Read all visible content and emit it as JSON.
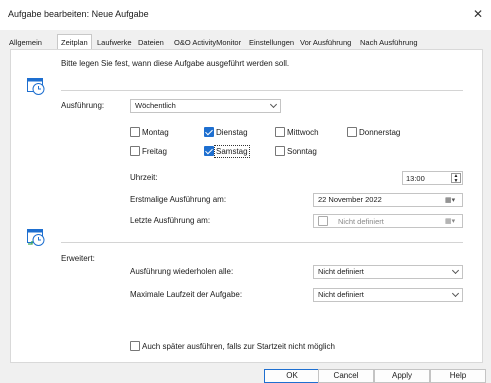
{
  "window": {
    "title": "Aufgabe bearbeiten: Neue Aufgabe"
  },
  "tabs": [
    {
      "label": "Allgemein"
    },
    {
      "label": "Zeitplan"
    },
    {
      "label": "Laufwerke"
    },
    {
      "label": "Dateien"
    },
    {
      "label": "O&O ActivityMonitor"
    },
    {
      "label": "Einstellungen"
    },
    {
      "label": "Vor Ausführung"
    },
    {
      "label": "Nach Ausführung"
    }
  ],
  "schedule": {
    "intro": "Bitte legen Sie fest, wann diese Aufgabe ausgeführt werden soll.",
    "execution_label": "Ausführung:",
    "frequency": "Wöchentlich",
    "days": [
      {
        "label": "Montag",
        "checked": false
      },
      {
        "label": "Dienstag",
        "checked": true
      },
      {
        "label": "Mittwoch",
        "checked": false
      },
      {
        "label": "Donnerstag",
        "checked": false
      },
      {
        "label": "Freitag",
        "checked": false
      },
      {
        "label": "Samstag",
        "checked": true
      },
      {
        "label": "Sonntag",
        "checked": false
      }
    ],
    "time_label": "Uhrzeit:",
    "time_value": "13:00",
    "first_run_label": "Erstmalige Ausführung am:",
    "first_run_value": "22 November 2022",
    "last_run_label": "Letzte Ausführung am:",
    "last_run_value": "Nicht definiert"
  },
  "advanced": {
    "label": "Erweitert:",
    "repeat_label": "Ausführung wiederholen alle:",
    "repeat_value": "Nicht definiert",
    "max_runtime_label": "Maximale Laufzeit der Aufgabe:",
    "max_runtime_value": "Nicht definiert",
    "run_later_label": "Auch später ausführen, falls zur Startzeit nicht möglich"
  },
  "buttons": {
    "ok": "OK",
    "cancel": "Cancel",
    "apply": "Apply",
    "help": "Help"
  },
  "colors": {
    "accent": "#1e6fd0",
    "icon_green": "#3aa55a"
  }
}
